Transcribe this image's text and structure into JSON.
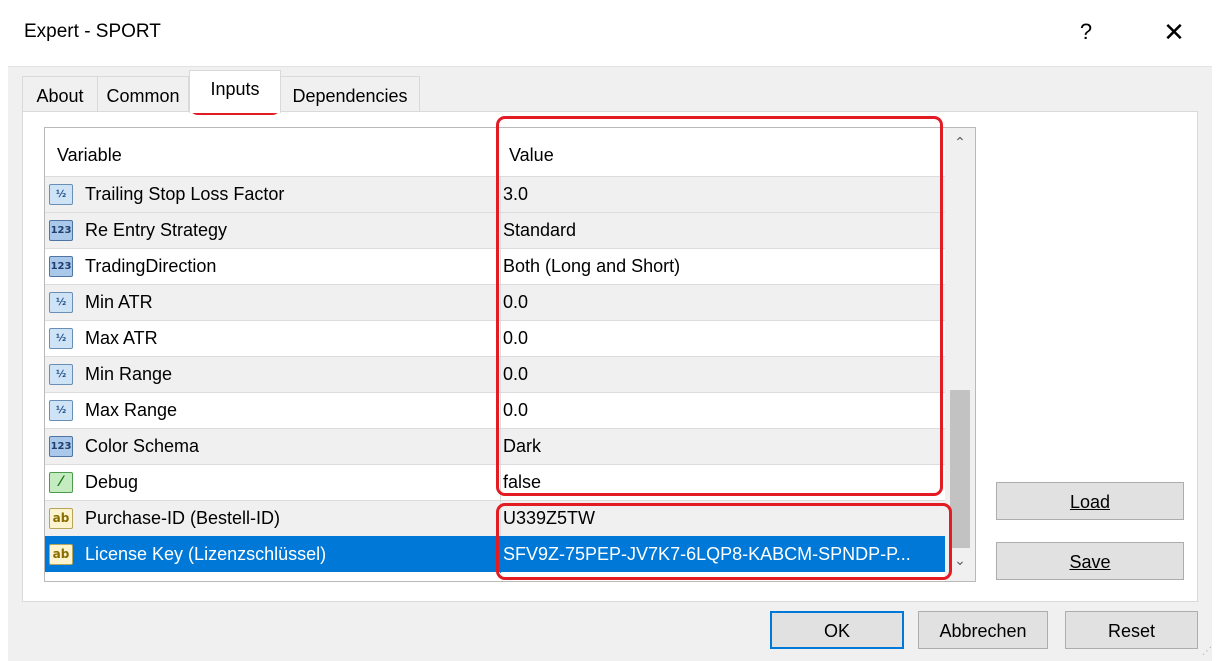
{
  "window": {
    "title": "Expert - SPORT",
    "help_label": "?",
    "close_label": "✕"
  },
  "tabs": [
    {
      "label": "About"
    },
    {
      "label": "Common"
    },
    {
      "label": "Inputs"
    },
    {
      "label": "Dependencies"
    }
  ],
  "grid": {
    "header_variable": "Variable",
    "header_value": "Value",
    "rows": [
      {
        "icon": "double-icon",
        "icon_text": "½",
        "variable": "Trailing Stop Loss Factor",
        "value": "3.0"
      },
      {
        "icon": "enum-icon",
        "icon_text": "123",
        "variable": "Re Entry Strategy",
        "value": "Standard"
      },
      {
        "icon": "enum-icon",
        "icon_text": "123",
        "variable": "TradingDirection",
        "value": "Both (Long and Short)"
      },
      {
        "icon": "double-icon",
        "icon_text": "½",
        "variable": "Min ATR",
        "value": "0.0"
      },
      {
        "icon": "double-icon",
        "icon_text": "½",
        "variable": "Max ATR",
        "value": "0.0"
      },
      {
        "icon": "double-icon",
        "icon_text": "½",
        "variable": "Min Range",
        "value": "0.0"
      },
      {
        "icon": "double-icon",
        "icon_text": "½",
        "variable": "Max Range",
        "value": "0.0"
      },
      {
        "icon": "enum-icon",
        "icon_text": "123",
        "variable": "Color Schema",
        "value": "Dark"
      },
      {
        "icon": "bool-icon",
        "icon_text": "⁄",
        "variable": "Debug",
        "value": "false"
      },
      {
        "icon": "string-icon",
        "icon_text": "ab",
        "variable": "Purchase-ID (Bestell-ID)",
        "value": "U339Z5TW"
      },
      {
        "icon": "string-icon",
        "icon_text": "ab",
        "variable": "License Key (Lizenzschlüssel)",
        "value": "SFV9Z-75PEP-JV7K7-6LQP8-KABCM-SPNDP-P..."
      }
    ],
    "scroll_up": "⌃",
    "scroll_down": "⌄"
  },
  "buttons": {
    "load_label": "Load",
    "save_label": "Save",
    "ok_label": "OK",
    "cancel_label": "Abbrechen",
    "reset_label": "Reset"
  },
  "colors": {
    "selection": "#0078d7",
    "highlight": "#e31b23"
  }
}
